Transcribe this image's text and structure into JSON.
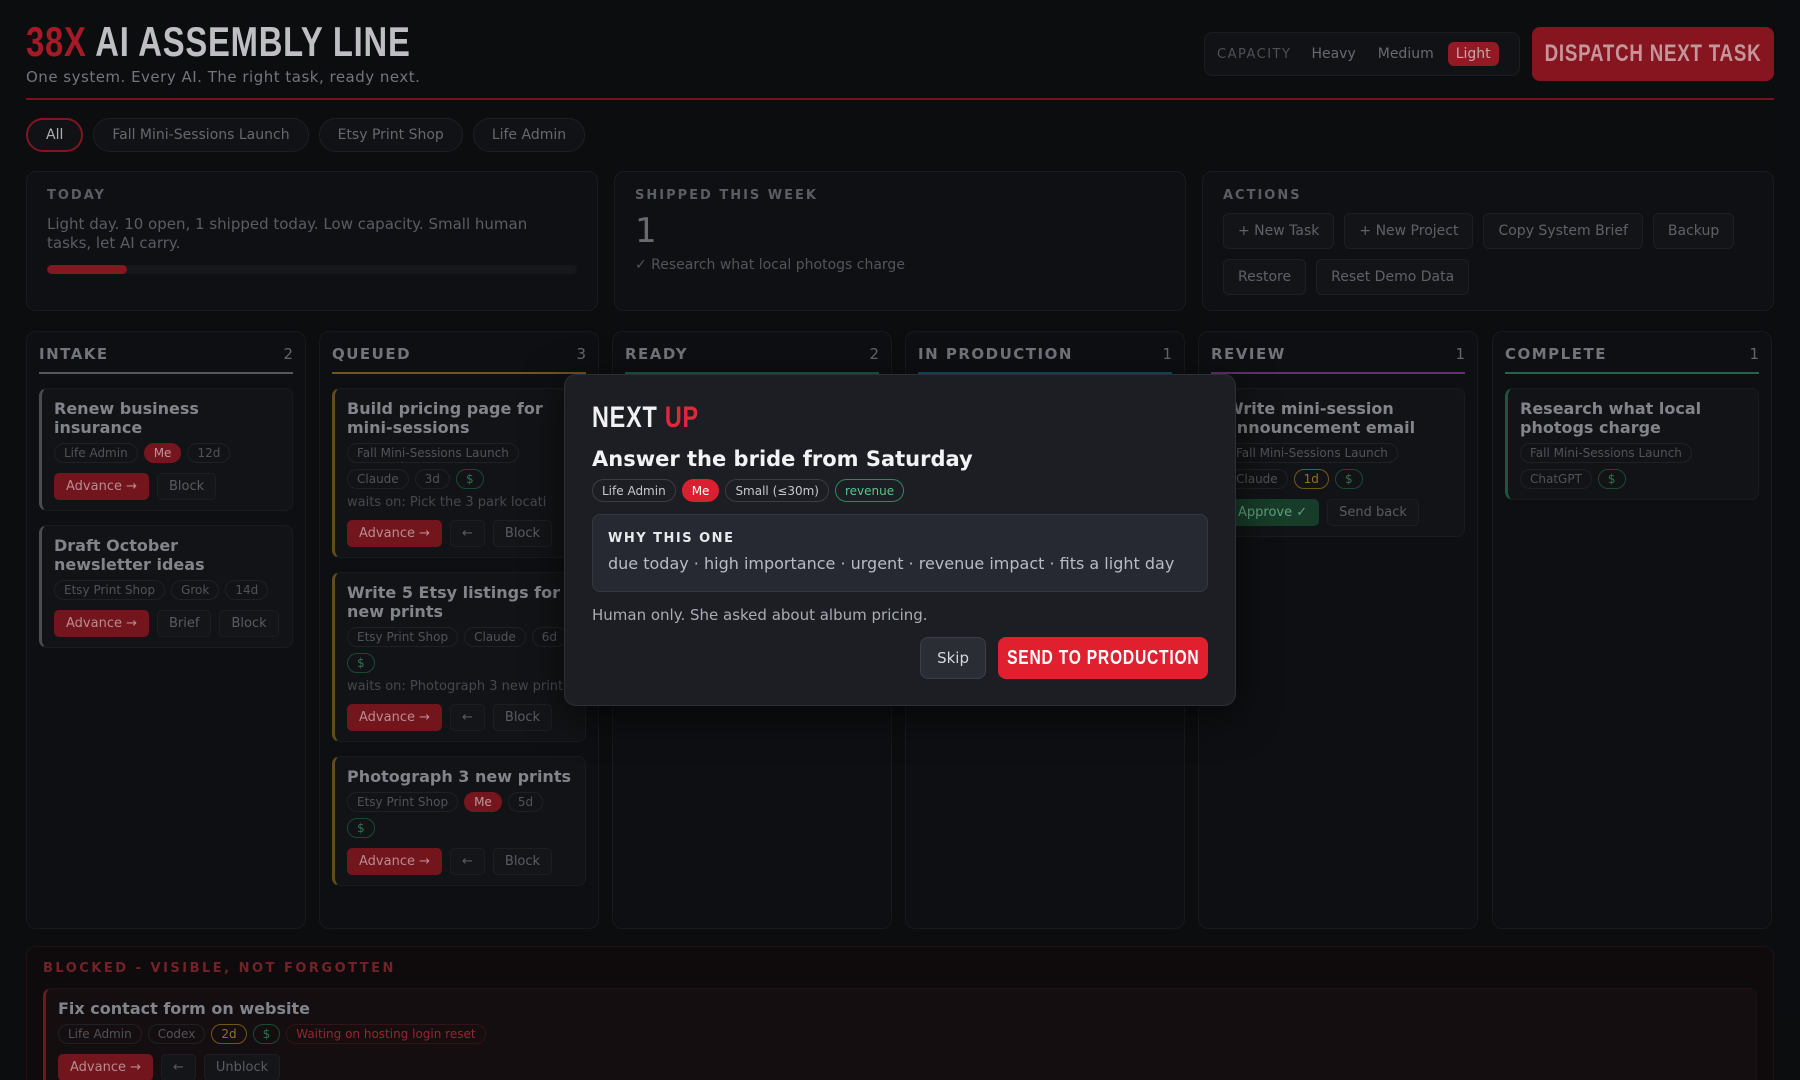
{
  "header": {
    "brand_accent": "38X",
    "brand_rest": "AI ASSEMBLY LINE",
    "subtitle": "One system. Every AI. The right task, ready next.",
    "capacity_label": "CAPACITY",
    "capacity_options": [
      "Heavy",
      "Medium",
      "Light"
    ],
    "capacity_selected": "Light",
    "dispatch_label": "DISPATCH NEXT TASK"
  },
  "filters": [
    "All",
    "Fall Mini-Sessions Launch",
    "Etsy Print Shop",
    "Life Admin"
  ],
  "today": {
    "label": "TODAY",
    "text": "Light day. 10 open, 1 shipped today. Low capacity. Small human tasks, let AI carry.",
    "progress_fraction": 0.15
  },
  "shipped": {
    "label": "SHIPPED THIS WEEK",
    "count": "1",
    "item": "✓ Research what local photogs charge"
  },
  "actions": {
    "label": "ACTIONS",
    "buttons": [
      "+ New Task",
      "+ New Project",
      "Copy System Brief",
      "Backup",
      "Restore",
      "Reset Demo Data"
    ]
  },
  "columns": {
    "intake": {
      "title": "INTAKE",
      "count": "2",
      "cards": [
        {
          "title": "Renew business insurance",
          "tags": [
            "Life Admin",
            "Me",
            "12d"
          ],
          "btns": [
            "Advance →",
            "Block"
          ]
        },
        {
          "title": "Draft October newsletter ideas",
          "tags": [
            "Etsy Print Shop",
            "Grok",
            "14d"
          ],
          "btns": [
            "Advance →",
            "Brief",
            "Block"
          ]
        }
      ]
    },
    "queued": {
      "title": "QUEUED",
      "count": "3",
      "cards": [
        {
          "title": "Build pricing page for mini-sessions",
          "tags": [
            "Fall Mini-Sessions Launch",
            "Claude",
            "3d",
            "$"
          ],
          "waits": "waits on: Pick the 3 park locati",
          "btns": [
            "Advance →",
            "←",
            "Block"
          ]
        },
        {
          "title": "Write 5 Etsy listings for new prints",
          "tags": [
            "Etsy Print Shop",
            "Claude",
            "6d",
            "$"
          ],
          "waits": "waits on: Photograph 3 new print",
          "btns": [
            "Advance →",
            "←",
            "Block"
          ]
        },
        {
          "title": "Photograph 3 new prints",
          "tags": [
            "Etsy Print Shop",
            "Me",
            "5d",
            "$"
          ],
          "btns": [
            "Advance →",
            "←",
            "Block"
          ]
        }
      ]
    },
    "ready": {
      "title": "READY",
      "count": "2"
    },
    "production": {
      "title": "IN PRODUCTION",
      "count": "1"
    },
    "review": {
      "title": "REVIEW",
      "count": "1",
      "cards": [
        {
          "title": "Write mini-session announcement email",
          "tags": [
            "Fall Mini-Sessions Launch",
            "Claude",
            "1d",
            "$"
          ],
          "btns": [
            "Approve ✓",
            "Send back"
          ]
        }
      ]
    },
    "complete": {
      "title": "COMPLETE",
      "count": "1",
      "cards": [
        {
          "title": "Research what local photogs charge",
          "tags": [
            "Fall Mini-Sessions Launch",
            "ChatGPT",
            "$"
          ]
        }
      ]
    }
  },
  "blocked": {
    "label": "BLOCKED - VISIBLE, NOT FORGOTTEN",
    "card": {
      "title": "Fix contact form on website",
      "tags": [
        "Life Admin",
        "Codex",
        "2d",
        "$",
        "Waiting on hosting login reset"
      ],
      "btns": [
        "Advance →",
        "←",
        "Unblock"
      ]
    }
  },
  "modal": {
    "kicker_rest": "NEXT",
    "kicker_accent": "UP",
    "title": "Answer the bride from Saturday",
    "tags": [
      "Life Admin",
      "Me",
      "Small (≤30m)",
      "revenue"
    ],
    "why_label": "WHY THIS ONE",
    "why_text": "due today · high importance · urgent · revenue impact · fits a light day",
    "note": "Human only. She asked about album pricing.",
    "skip_label": "Skip",
    "send_label": "SEND TO PRODUCTION"
  },
  "colors": {
    "accent": "#c92130",
    "intake": "#6a6c73",
    "queued": "#8a6a24",
    "ready": "#1f6e52",
    "production": "#1f5f7a",
    "review": "#7a3a8a",
    "complete": "#2a7a55"
  }
}
